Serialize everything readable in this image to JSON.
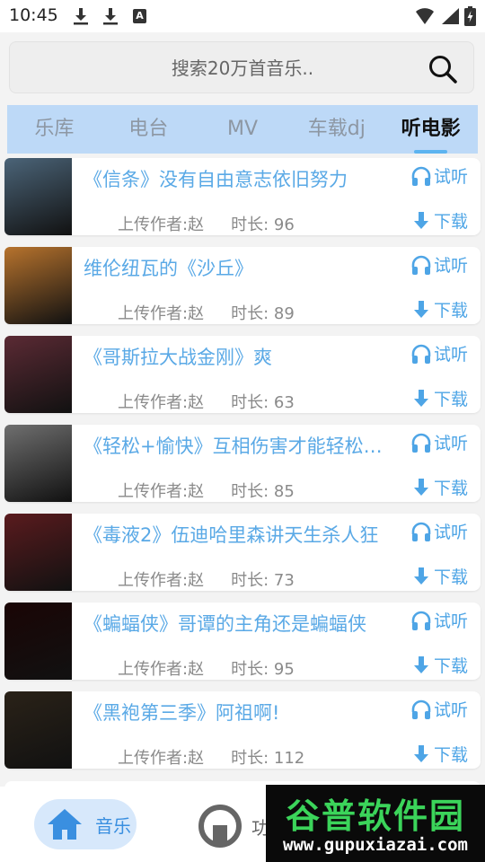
{
  "status_bar": {
    "time": "10:45",
    "icons": [
      "download-icon",
      "download-icon",
      "a-notification-icon",
      "wifi-icon",
      "signal-icon",
      "battery-charging-icon"
    ]
  },
  "search": {
    "placeholder": "搜索20万首音乐..",
    "icon": "search-icon"
  },
  "tabs": [
    {
      "label": "乐库",
      "active": false
    },
    {
      "label": "电台",
      "active": false
    },
    {
      "label": "MV",
      "active": false
    },
    {
      "label": "车载dj",
      "active": false
    },
    {
      "label": "听电影",
      "active": true
    }
  ],
  "list_items": [
    {
      "title": "《信条》没有自由意志依旧努力",
      "uploader": "上传作者:赵",
      "duration": "时长: 96",
      "listen": "试听",
      "download": "下载",
      "thumb_color": "#4b6478"
    },
    {
      "title": "维伦纽瓦的《沙丘》",
      "uploader": "上传作者:赵",
      "duration": "时长: 89",
      "listen": "试听",
      "download": "下载",
      "thumb_color": "#b7732d"
    },
    {
      "title": "《哥斯拉大战金刚》爽",
      "uploader": "上传作者:赵",
      "duration": "时长: 63",
      "listen": "试听",
      "download": "下载",
      "thumb_color": "#5b2a34"
    },
    {
      "title": "《轻松+愉快》互相伤害才能轻松愉快",
      "uploader": "上传作者:赵",
      "duration": "时长: 85",
      "listen": "试听",
      "download": "下载",
      "thumb_color": "#6f6f6f"
    },
    {
      "title": "《毒液2》伍迪哈里森讲天生杀人狂",
      "uploader": "上传作者:赵",
      "duration": "时长: 73",
      "listen": "试听",
      "download": "下载",
      "thumb_color": "#5a1b1e"
    },
    {
      "title": "《蝙蝠侠》哥谭的主角还是蝙蝠侠",
      "uploader": "上传作者:赵",
      "duration": "时长: 95",
      "listen": "试听",
      "download": "下载",
      "thumb_color": "#1a0505"
    },
    {
      "title": "《黑袍第三季》阿祖啊!",
      "uploader": "上传作者:赵",
      "duration": "时长: 112",
      "listen": "试听",
      "download": "下载",
      "thumb_color": "#2a2218"
    }
  ],
  "bottom_nav": {
    "music_label": "音乐",
    "func_label": "功"
  },
  "watermark": {
    "text": "谷普软件园",
    "url": "www.gupuxiazai.com"
  },
  "colors": {
    "accent": "#5aa9e6",
    "tab_bar": "#bdd9f7",
    "nav_active_bg": "#d7e8fb"
  }
}
